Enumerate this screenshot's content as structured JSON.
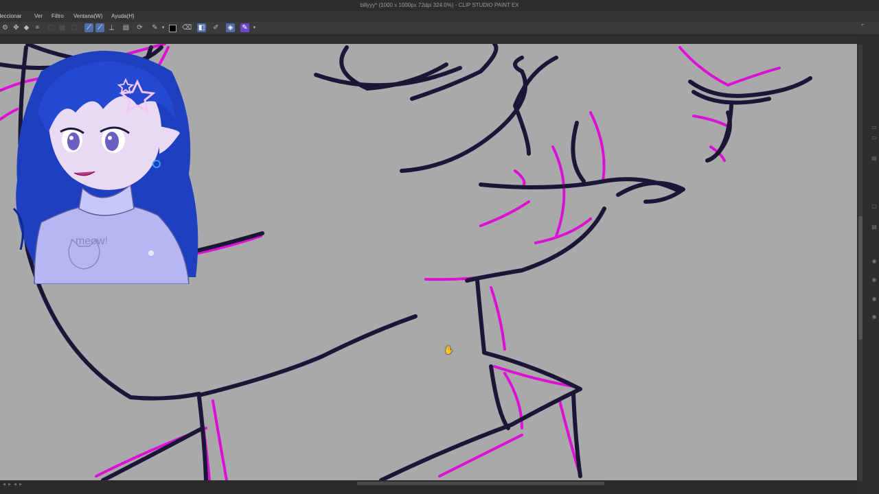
{
  "window": {
    "title": "billyyy* (1000 x 1000px 72dpi 324.0%) - CLIP STUDIO PAINT EX"
  },
  "menu": {
    "items": [
      {
        "label": "eleccionar"
      },
      {
        "label": "Ver"
      },
      {
        "label": "Filtro"
      },
      {
        "label": "Ventana(W)"
      },
      {
        "label": "Ayuda(H)"
      }
    ]
  },
  "toolbar": {
    "icons": [
      "select-icon",
      "move-icon",
      "crop-icon",
      "shape-icon",
      "fill-icon",
      "pen-icon",
      "pen-active-icon",
      "ruler-icon",
      "layer-icon",
      "layer-settings-icon",
      "pencil-icon",
      "color-swatch",
      "eraser-icon",
      "gradient-icon",
      "eyedropper-icon",
      "smudge-icon",
      "vector-icon"
    ],
    "main_color": "#000000",
    "accent": "#6e47c9"
  },
  "canvas": {
    "background": "#a9a9ab",
    "line_color": "#1b1636",
    "sketch_color": "#e200d9"
  },
  "overlay": {
    "sweater_text": "meow!"
  }
}
